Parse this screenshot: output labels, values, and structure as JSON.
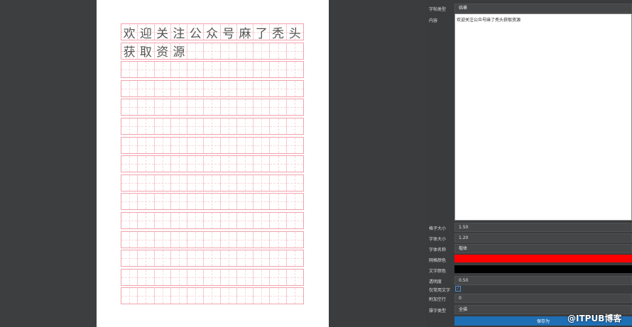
{
  "panel": {
    "tie_type": {
      "label": "字帖类型",
      "value": "临摹"
    },
    "content": {
      "label": "内容",
      "value": "欢迎关注公众号麻了秃头获取资源"
    },
    "grid_size": {
      "label": "格子大小",
      "value": "1.50"
    },
    "font_size": {
      "label": "字体大小",
      "value": "1.20"
    },
    "font_name": {
      "label": "字体名称",
      "value": "楷体"
    },
    "grid_color": {
      "label": "网格颜色",
      "value": "#ff0000"
    },
    "text_color": {
      "label": "文字颜色",
      "value": "#000000"
    },
    "opacity": {
      "label": "透明度",
      "value": "0.50"
    },
    "common_only": {
      "label": "仅常用文字",
      "checked": true
    },
    "extra_blank": {
      "label": "附加空行",
      "value": "0"
    },
    "practice_type": {
      "label": "操字类型",
      "value": "全描"
    },
    "save_label": "保存为"
  },
  "paper": {
    "rows": [
      [
        "欢",
        "迎",
        "关",
        "注",
        "公",
        "众",
        "号",
        "麻",
        "了",
        "秃",
        "头"
      ],
      [
        "获",
        "取",
        "资",
        "源",
        "",
        "",
        "",
        "",
        "",
        "",
        ""
      ],
      [
        "",
        "",
        "",
        "",
        "",
        "",
        "",
        "",
        "",
        "",
        ""
      ],
      [
        "",
        "",
        "",
        "",
        "",
        "",
        "",
        "",
        "",
        "",
        ""
      ],
      [
        "",
        "",
        "",
        "",
        "",
        "",
        "",
        "",
        "",
        "",
        ""
      ],
      [
        "",
        "",
        "",
        "",
        "",
        "",
        "",
        "",
        "",
        "",
        ""
      ],
      [
        "",
        "",
        "",
        "",
        "",
        "",
        "",
        "",
        "",
        "",
        ""
      ],
      [
        "",
        "",
        "",
        "",
        "",
        "",
        "",
        "",
        "",
        "",
        ""
      ],
      [
        "",
        "",
        "",
        "",
        "",
        "",
        "",
        "",
        "",
        "",
        ""
      ],
      [
        "",
        "",
        "",
        "",
        "",
        "",
        "",
        "",
        "",
        "",
        ""
      ],
      [
        "",
        "",
        "",
        "",
        "",
        "",
        "",
        "",
        "",
        "",
        ""
      ],
      [
        "",
        "",
        "",
        "",
        "",
        "",
        "",
        "",
        "",
        "",
        ""
      ],
      [
        "",
        "",
        "",
        "",
        "",
        "",
        "",
        "",
        "",
        "",
        ""
      ],
      [
        "",
        "",
        "",
        "",
        "",
        "",
        "",
        "",
        "",
        "",
        ""
      ],
      [
        "",
        "",
        "",
        "",
        "",
        "",
        "",
        "",
        "",
        "",
        ""
      ]
    ]
  },
  "watermark": "@ITPUB博客"
}
